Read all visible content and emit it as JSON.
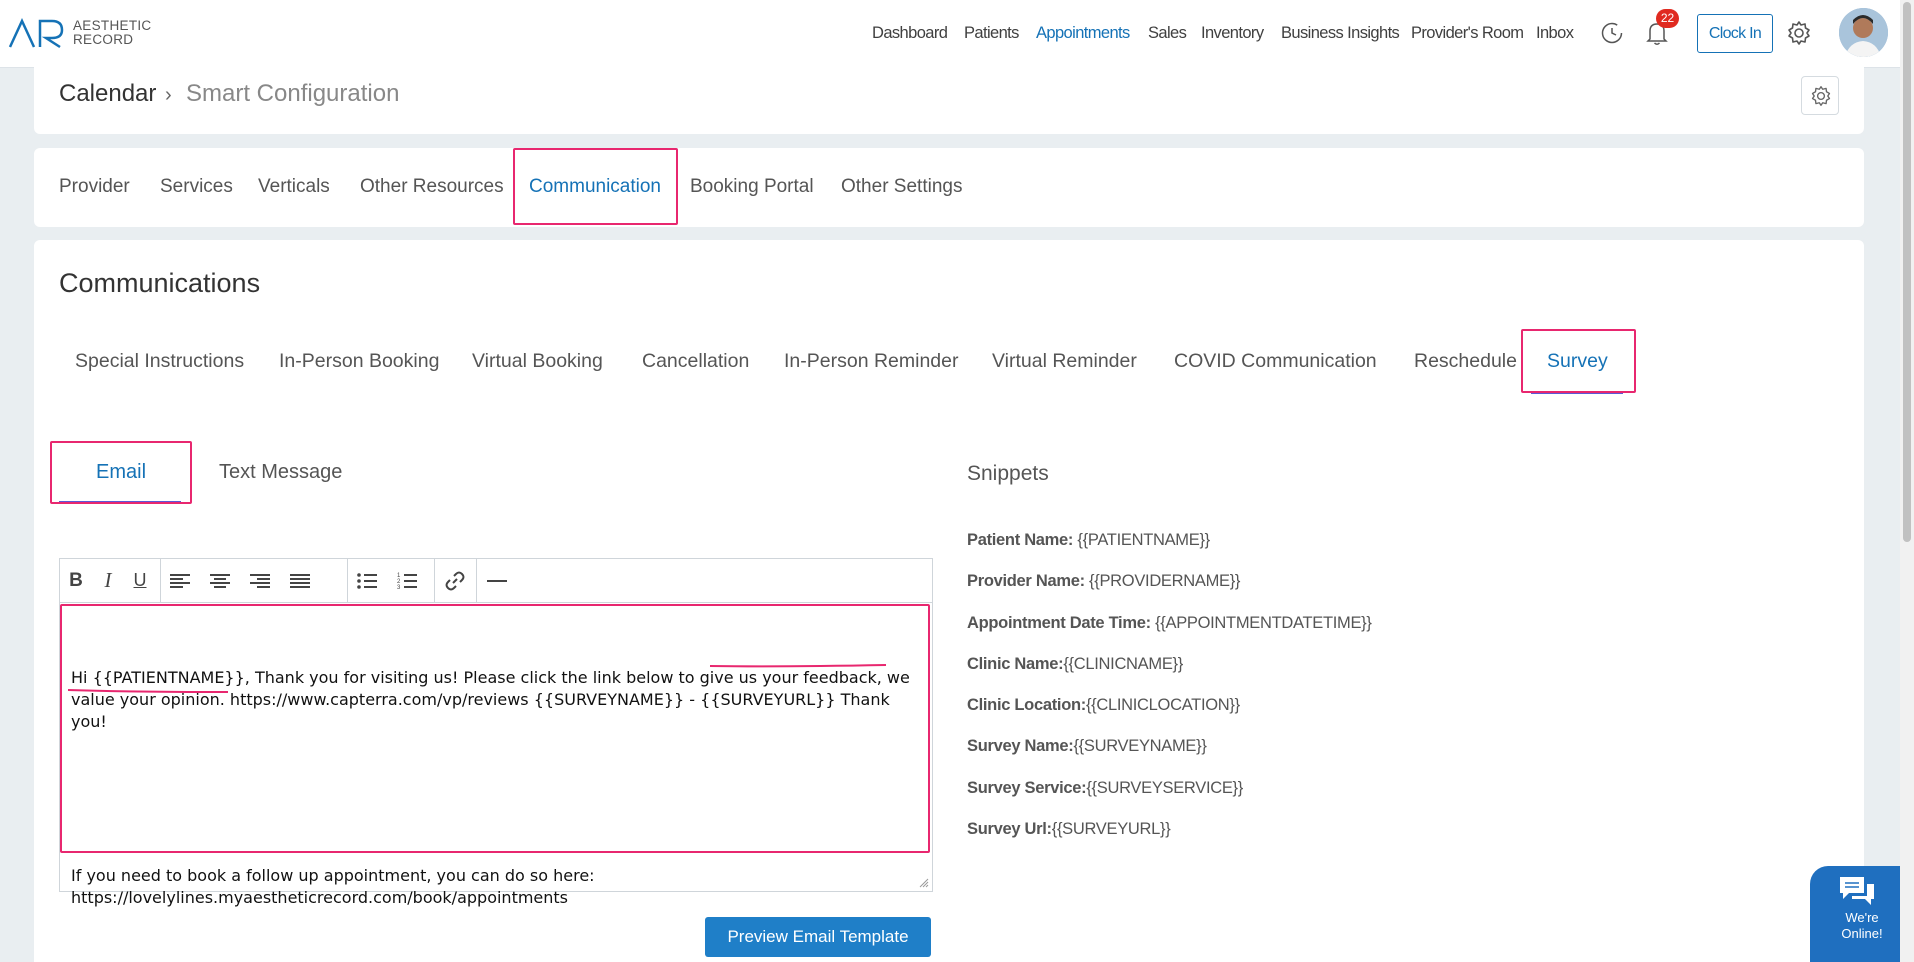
{
  "brand": {
    "line1": "AESTHETIC",
    "line2": "RECORD"
  },
  "nav": {
    "items": [
      {
        "label": "Dashboard"
      },
      {
        "label": "Patients"
      },
      {
        "label": "Appointments"
      },
      {
        "label": "Sales"
      },
      {
        "label": "Inventory"
      },
      {
        "label": "Business Insights"
      },
      {
        "label": "Provider's Room"
      },
      {
        "label": "Inbox"
      }
    ],
    "active": "Appointments",
    "notification_count": "22",
    "clock_in": "Clock In"
  },
  "breadcrumb": {
    "root": "Calendar",
    "separator": "›",
    "current": "Smart Configuration"
  },
  "settings_tabs": [
    {
      "label": "Provider"
    },
    {
      "label": "Services"
    },
    {
      "label": "Verticals"
    },
    {
      "label": "Other Resources"
    },
    {
      "label": "Communication"
    },
    {
      "label": "Booking Portal"
    },
    {
      "label": "Other Settings"
    }
  ],
  "communications": {
    "title": "Communications",
    "tabs": [
      {
        "label": "Special Instructions"
      },
      {
        "label": "In-Person Booking"
      },
      {
        "label": "Virtual Booking"
      },
      {
        "label": "Cancellation"
      },
      {
        "label": "In-Person Reminder"
      },
      {
        "label": "Virtual Reminder"
      },
      {
        "label": "COVID Communication"
      },
      {
        "label": "Reschedule"
      },
      {
        "label": "Survey"
      }
    ],
    "active_tab": "Survey"
  },
  "message_tabs": {
    "email": "Email",
    "text": "Text Message",
    "active": "Email"
  },
  "editor": {
    "body_part1": "Hi {{PATIENTNAME}}, Thank you for visiting us! Please click the link below to give us your feedback, we value your opinion. https://www.capterra.com/vp/reviews {{SURVEYNAME}} - {{SURVEYURL}} Thank you!",
    "body_part2": "If you need to book a follow up appointment, you can do so here: https://lovelylines.myaestheticrecord.com/book/appointments"
  },
  "preview_button": "Preview Email Template",
  "snippets": {
    "title": "Snippets",
    "items": [
      {
        "label": "Patient Name:",
        "value": " {{PATIENTNAME}}"
      },
      {
        "label": "Provider Name:",
        "value": " {{PROVIDERNAME}}"
      },
      {
        "label": "Appointment Date Time:",
        "value": " {{APPOINTMENTDATETIME}}"
      },
      {
        "label": "Clinic Name:",
        "value": "{{CLINICNAME}}"
      },
      {
        "label": "Clinic Location:",
        "value": "{{CLINICLOCATION}}"
      },
      {
        "label": "Survey Name:",
        "value": "{{SURVEYNAME}}"
      },
      {
        "label": "Survey Service:",
        "value": "{{SURVEYSERVICE}}"
      },
      {
        "label": "Survey Url:",
        "value": "{{SURVEYURL}}"
      }
    ]
  },
  "chat": {
    "line1": "We're",
    "line2": "Online!"
  },
  "colors": {
    "accent": "#1572b6",
    "highlight": "#e8276f",
    "badge": "#e02a20",
    "button": "#1f7fc8"
  },
  "icons": [
    "history-icon",
    "bell-icon",
    "gear-icon",
    "chat-icon"
  ]
}
